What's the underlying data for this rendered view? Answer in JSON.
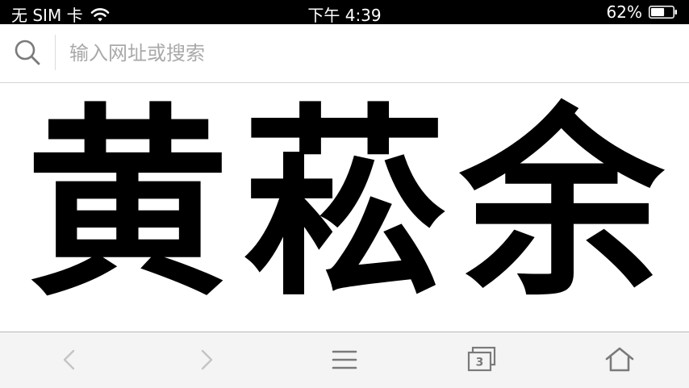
{
  "status_bar": {
    "carrier": "无 SIM 卡",
    "time": "下午 4:39",
    "battery_percent": "62%",
    "battery_level": 0.62,
    "wifi_icon": "wifi-icon",
    "battery_icon": "battery-icon"
  },
  "url_bar": {
    "placeholder": "输入网址或搜索",
    "value": "",
    "icon": "search-icon"
  },
  "content": {
    "characters": [
      "黄",
      "菘",
      "余"
    ]
  },
  "toolbar": {
    "back_icon": "chevron-left-icon",
    "forward_icon": "chevron-right-icon",
    "menu_icon": "menu-icon",
    "tabs_icon": "tabs-icon",
    "tab_count": "3",
    "home_icon": "home-icon"
  },
  "colors": {
    "status_bar_bg": "#000000",
    "toolbar_bg": "#f4f4f4",
    "icon_gray": "#7a7a7a",
    "disabled_icon": "#c4c4c4"
  }
}
